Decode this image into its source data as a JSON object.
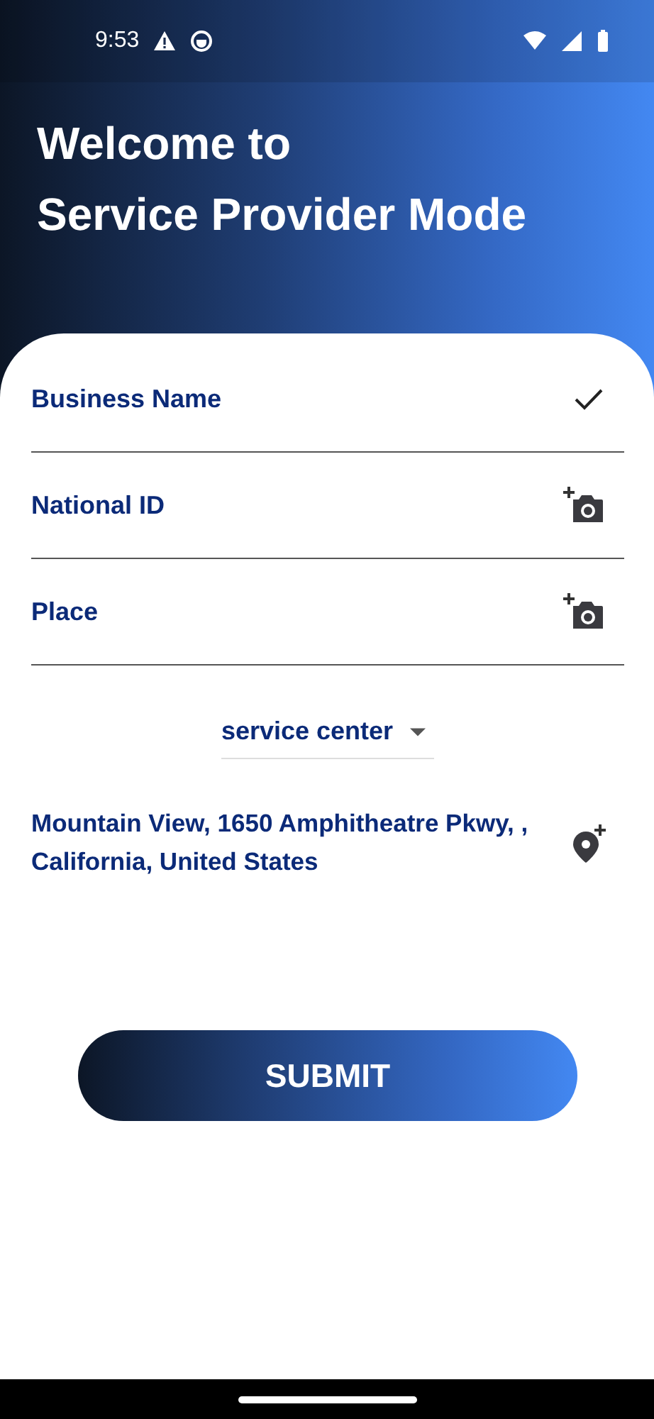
{
  "status_bar": {
    "time": "9:53"
  },
  "header": {
    "title_lines": [
      "Welcome to",
      "Service Provider Mode"
    ]
  },
  "fields": [
    {
      "label": "Business Name",
      "kind": "check"
    },
    {
      "label": "National ID",
      "kind": "camera"
    },
    {
      "label": "Place",
      "kind": "camera"
    }
  ],
  "dropdown": {
    "value": "service center"
  },
  "address": {
    "text": "Mountain View, 1650 Amphitheatre Pkwy, , California, United States"
  },
  "submit_button": {
    "label": "SUBMIT"
  }
}
